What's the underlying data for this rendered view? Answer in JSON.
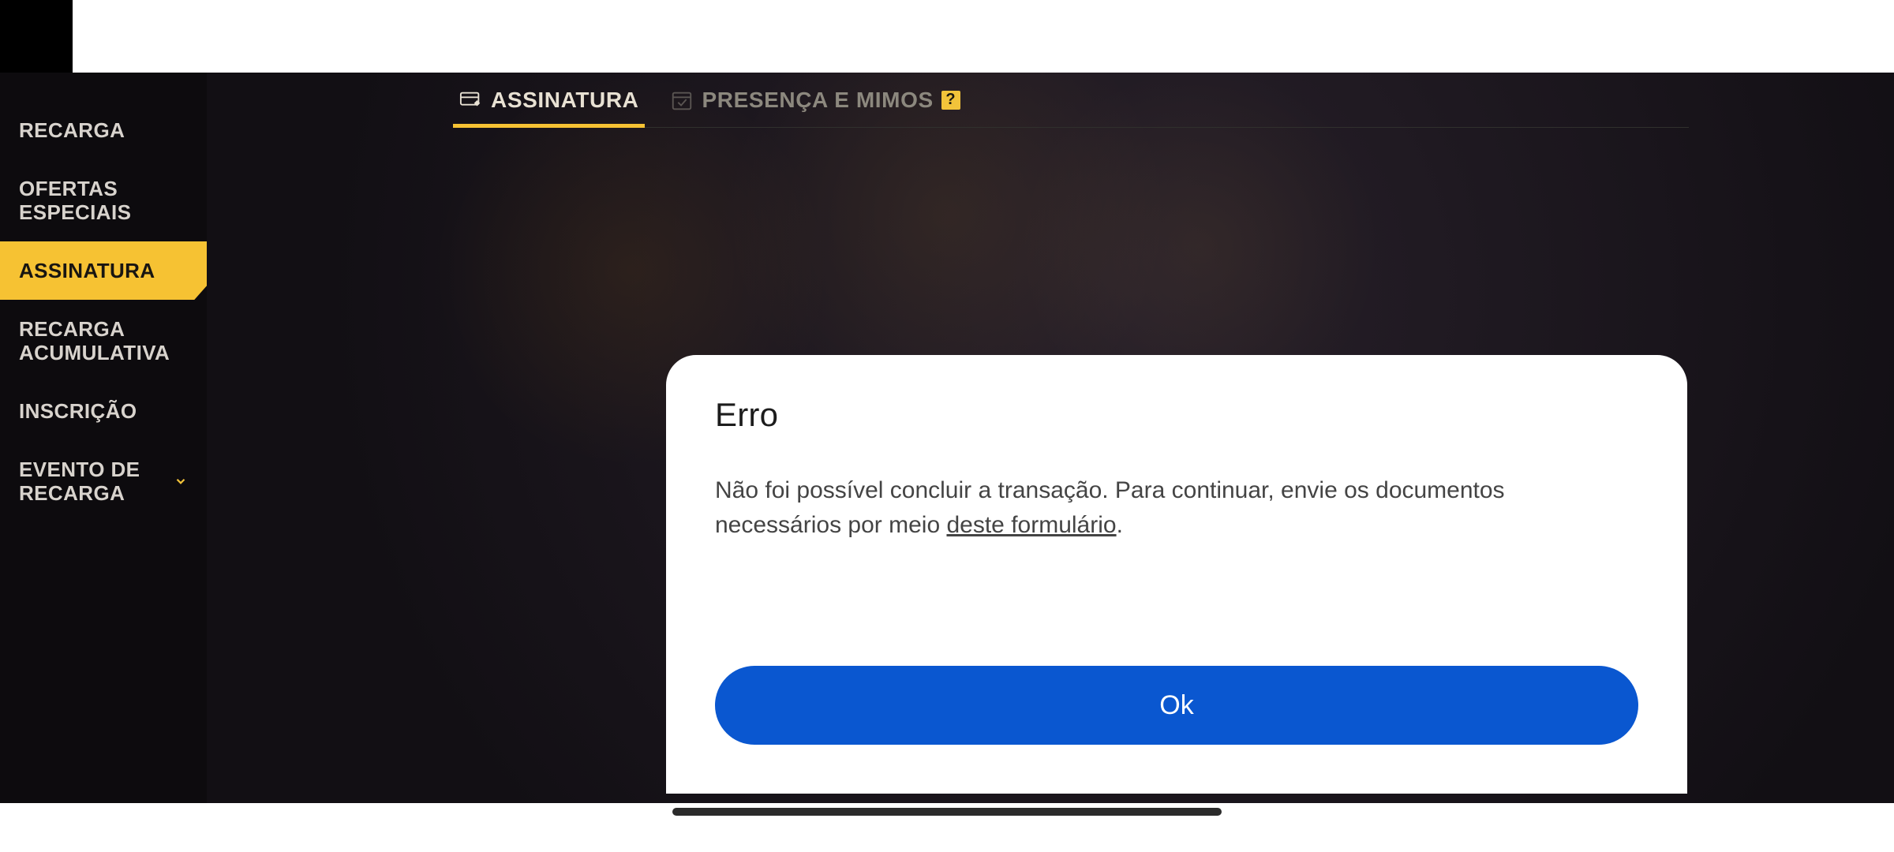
{
  "sidebar": {
    "items": [
      {
        "label": "RECARGA"
      },
      {
        "label": "OFERTAS\nESPECIAIS"
      },
      {
        "label": "ASSINATURA"
      },
      {
        "label": "RECARGA\nACUMULATIVA"
      },
      {
        "label": "INSCRIÇÃO"
      },
      {
        "label": "EVENTO DE\nRECARGA"
      }
    ]
  },
  "tabs": {
    "items": [
      {
        "label": "ASSINATURA"
      },
      {
        "label": "PRESENÇA E MIMOS"
      }
    ],
    "help_symbol": "?"
  },
  "modal": {
    "title": "Erro",
    "body_pre": "Não foi possível concluir a transação. Para continuar, envie os documentos necessários por meio ",
    "body_link": "deste formulário",
    "body_post": ".",
    "ok_label": "Ok"
  }
}
